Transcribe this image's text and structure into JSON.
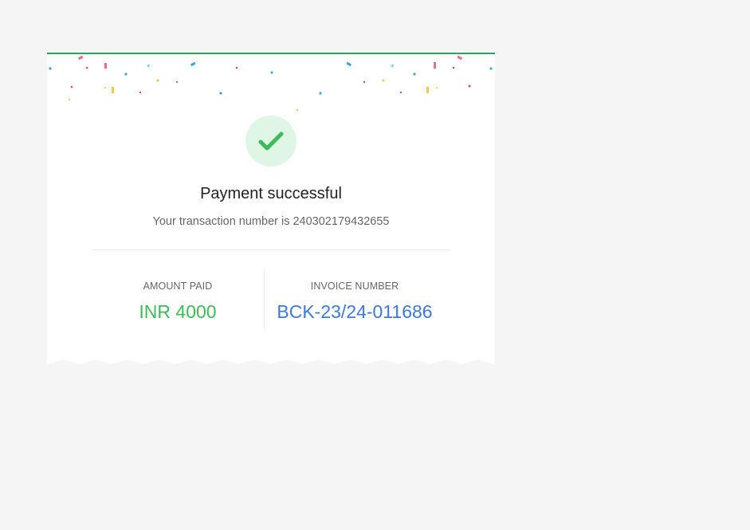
{
  "receipt": {
    "title": "Payment successful",
    "subtitle": "Your transaction number is 240302179432655",
    "amount_label": "AMOUNT PAID",
    "amount_value": "INR 4000",
    "invoice_label": "INVOICE NUMBER",
    "invoice_value": "BCK-23/24-011686"
  },
  "icons": {
    "success": "check-icon",
    "decoration": "confetti"
  },
  "colors": {
    "page_background": "#f5f5f5",
    "card_background": "#ffffff",
    "top_border": "#27a55a",
    "check": "#3dbb55",
    "check_circle": "#dff5e6",
    "amount": "#3dbb55",
    "invoice": "#3d78e0"
  }
}
